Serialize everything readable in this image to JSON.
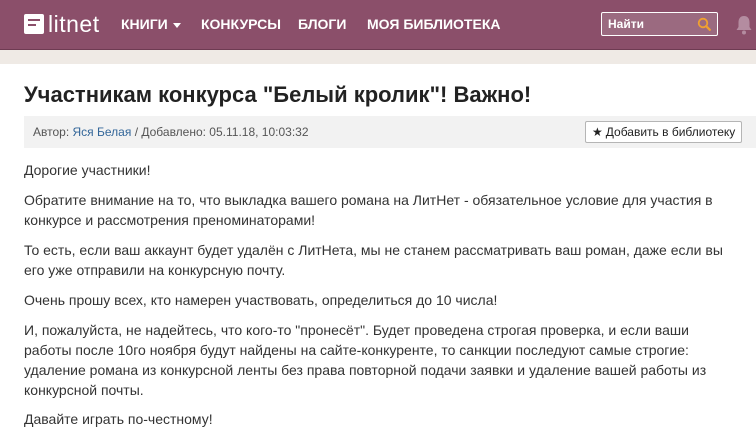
{
  "header": {
    "logo_text": "litnet",
    "nav": [
      "КНИГИ",
      "КОНКУРСЫ",
      "БЛОГИ",
      "МОЯ БИБЛИОТЕКА"
    ],
    "search_placeholder": "Найти",
    "bg_color": "#8b4f6a"
  },
  "article": {
    "title": "Участникам конкурса \"Белый кролик\"! Важно!",
    "author_prefix": "Автор:",
    "author_name": "Яся Белая",
    "added_text": "/ Добавлено: 05.11.18, 10:03:32",
    "add_library_label": "Добавить в библиотеку",
    "paragraphs": [
      "Дорогие участники!",
      "Обратите внимание на то, что выкладка вашего романа на ЛитНет - обязательное условие для участия в конкурсе и рассмотрения преноминаторами!",
      "То есть, если ваш аккаунт будет удалён с ЛитНета, мы не станем рассматривать ваш роман, даже если вы его уже отправили на конкурсную почту.",
      "Очень прошу всех, кто намерен участвовать, определиться до 10 числа!",
      "И, пожалуйста, не надейтесь, что кого-то \"пронесёт\". Будет проведена строгая проверка, и если ваши работы после 10го ноября будут найдены на сайте-конкуренте, то санкции последуют самые строгие: удаление романа из конкурсной ленты без права повторной подачи заявки и удаление вашей работы из конкурсной почты.",
      "Давайте играть по-честному!"
    ]
  },
  "icons": {
    "logo": "book-icon",
    "search": "search-icon",
    "notifications": "bell-icon",
    "caret": "chevron-down-icon",
    "add": "star-icon"
  }
}
